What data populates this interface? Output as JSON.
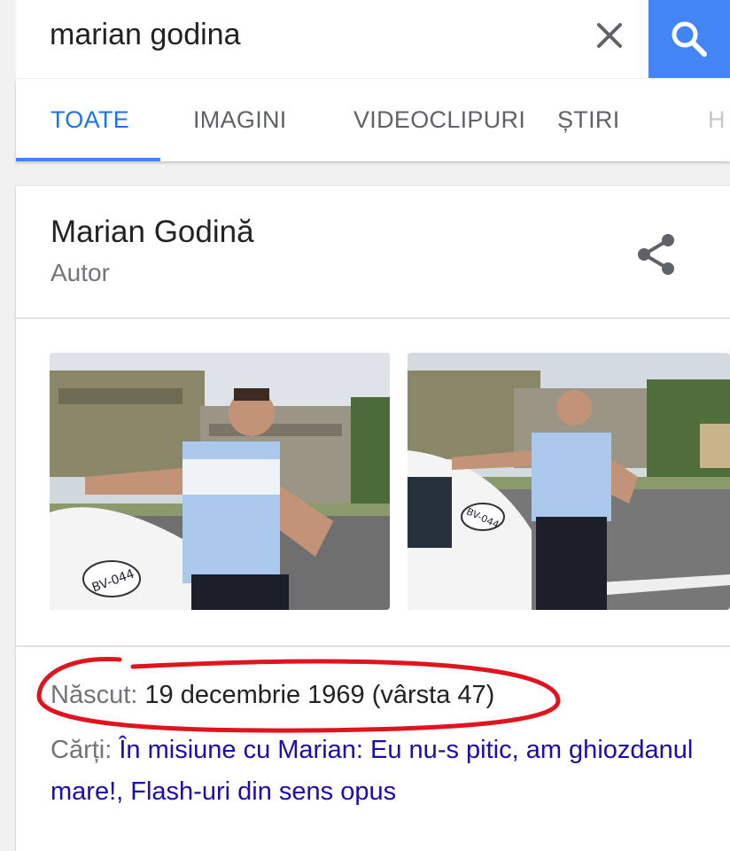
{
  "search": {
    "query": "marian godina",
    "clear_icon": "close-icon",
    "search_icon": "search-icon",
    "accent": "#4285f4"
  },
  "tabs": [
    {
      "label": "TOATE",
      "active": true
    },
    {
      "label": "IMAGINI",
      "active": false
    },
    {
      "label": "VIDEOCLIPURI",
      "active": false
    },
    {
      "label": "ȘTIRI",
      "active": false
    },
    {
      "label": "H",
      "active": false
    }
  ],
  "card": {
    "title": "Marian Godină",
    "subtitle": "Autor",
    "share_icon": "share-icon",
    "images": [
      {
        "description": "photo-1",
        "car_plate": "BV-044"
      },
      {
        "description": "photo-2",
        "car_plate": "BV-044"
      }
    ],
    "facts": {
      "born_label": "Născut:",
      "born_value": " 19 decembrie 1969 (vârsta 47)",
      "books_label": "Cărți:",
      "book_1": "În misiune cu Marian: Eu nu-s pitic, am ghiozdanul mare!",
      "separator": ", ",
      "book_2": "Flash-uri din sens opus"
    },
    "annotation_color": "#e0141e"
  }
}
